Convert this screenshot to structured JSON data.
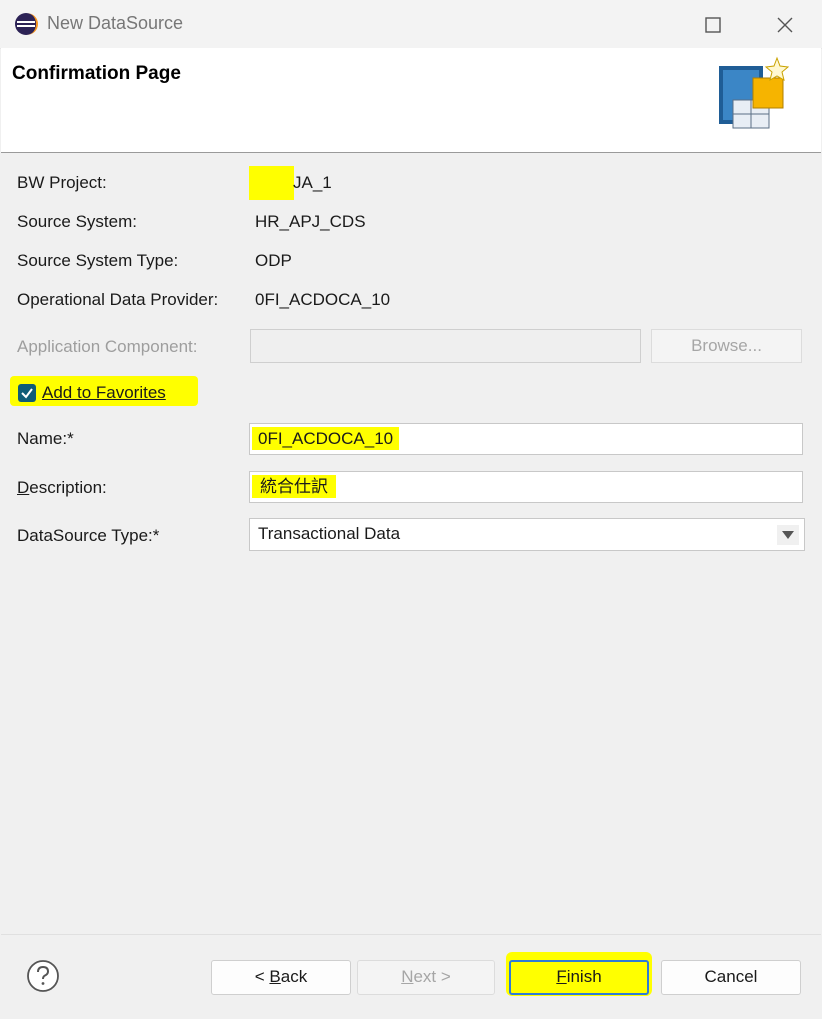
{
  "window": {
    "title": "New DataSource",
    "app_icon": "eclipse-icon",
    "maximize_icon": "maximize-icon",
    "close_icon": "close-icon"
  },
  "banner": {
    "title": "Confirmation Page",
    "graphic_icon": "datasource-wizard-icon"
  },
  "fields": {
    "bw_project": {
      "label": "BW Project:",
      "value": "JA_1"
    },
    "source_system": {
      "label": "Source System:",
      "value": "HR_APJ_CDS"
    },
    "source_system_type": {
      "label": "Source System Type:",
      "value": "ODP"
    },
    "operational_data_provider": {
      "label": "Operational Data Provider:",
      "value": "0FI_ACDOCA_10"
    },
    "application_component": {
      "label": "Application Component:",
      "value": "",
      "browse_label": "Browse..."
    },
    "add_to_favorites": {
      "label": "Add to Favorites",
      "checked": true
    },
    "name": {
      "label": "Name:*",
      "value": "0FI_ACDOCA_10"
    },
    "description": {
      "label": "Description:",
      "value": "統合仕訳"
    },
    "datasource_type": {
      "label": "DataSource Type:*",
      "value": "Transactional Data"
    }
  },
  "buttons": {
    "back": "< Back",
    "next": "Next >",
    "finish": "Finish",
    "cancel": "Cancel",
    "help_icon": "help-icon"
  },
  "colors": {
    "highlight": "#ffff00",
    "checkbox": "#0f5c78",
    "default_button_border": "#2f7ad8"
  }
}
